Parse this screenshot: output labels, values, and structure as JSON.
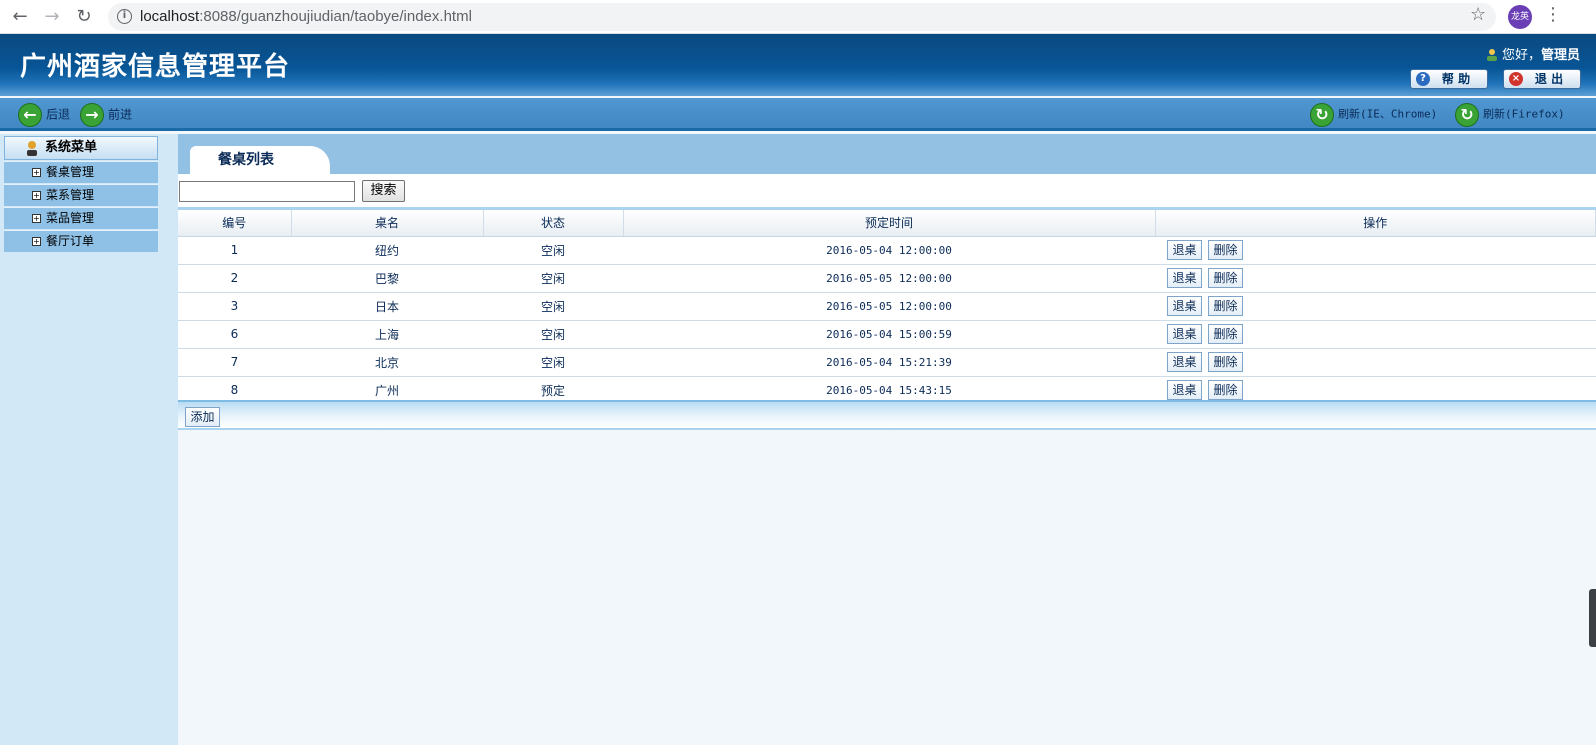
{
  "browser": {
    "url_host": "localhost",
    "url_rest": ":8088/guanzhoujiudian/taobye/index.html",
    "profile_label": "龙英"
  },
  "header": {
    "title": "广州酒家信息管理平台",
    "greeting": "您好，",
    "user": "管理员",
    "help_label": "帮 助",
    "logout_label": "退 出"
  },
  "toolbar": {
    "back": "后退",
    "forward": "前进",
    "refresh_ie": "刷新(IE、Chrome)",
    "refresh_ff": "刷新(Firefox)"
  },
  "sidebar": {
    "title": "系统菜单",
    "items": [
      "餐桌管理",
      "菜系管理",
      "菜品管理",
      "餐厅订单"
    ]
  },
  "main": {
    "tab_title": "餐桌列表",
    "search_placeholder": "",
    "search_label": "搜索",
    "columns": [
      "编号",
      "桌名",
      "状态",
      "预定时间",
      "操作"
    ],
    "rows": [
      {
        "id": "1",
        "name": "纽约",
        "status": "空闲",
        "time": "2016-05-04 12:00:00"
      },
      {
        "id": "2",
        "name": "巴黎",
        "status": "空闲",
        "time": "2016-05-05 12:00:00"
      },
      {
        "id": "3",
        "name": "日本",
        "status": "空闲",
        "time": "2016-05-05 12:00:00"
      },
      {
        "id": "6",
        "name": "上海",
        "status": "空闲",
        "time": "2016-05-04 15:00:59"
      },
      {
        "id": "7",
        "name": "北京",
        "status": "空闲",
        "time": "2016-05-04 15:21:39"
      },
      {
        "id": "8",
        "name": "广州",
        "status": "预定",
        "time": "2016-05-04 15:43:15"
      }
    ],
    "row_action_checkout": "退桌",
    "row_action_delete": "删除",
    "add_label": "添加"
  },
  "colors": {
    "header_dark": "#0b4a80",
    "toolbar_blue": "#4188c4",
    "sidebar_bg": "#d3e8f7",
    "menu_item": "#8fc0e6",
    "text_navy": "#0b2b57"
  }
}
